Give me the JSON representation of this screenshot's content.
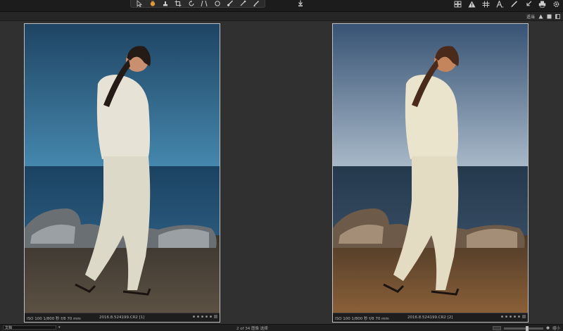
{
  "toolbar": {
    "tools": [
      "cursor-icon",
      "hand-icon",
      "stamp-icon",
      "crop-icon",
      "rotate-icon",
      "keystone-icon",
      "circle-icon",
      "brush-icon",
      "eyedropper-icon",
      "eraser-icon"
    ],
    "right_tools": [
      "grid-view-icon",
      "warning-icon",
      "grid-icon",
      "text-icon",
      "pen-icon",
      "compress-icon",
      "print-icon",
      "settings-icon"
    ]
  },
  "subbar": {
    "label": "适当"
  },
  "left_photo": {
    "caption_exif": "ISO 100  1/800 秒  f/8  70 mm",
    "caption_file": "2016.8.524199.CR2 [1]",
    "colors": {
      "sky_top": "#234c6b",
      "sky_bottom": "#3e7ea4",
      "sea": "#1f4666",
      "ground": "#4a4033"
    }
  },
  "right_photo": {
    "caption_exif": "ISO 100  1/800 秒  f/8  70 mm",
    "caption_file": "2016.8.524199.CR2 [2]",
    "colors": {
      "sky_top": "#3a5575",
      "sky_bottom": "#9fb2c4",
      "sea": "#2a3d52",
      "ground": "#6b4a2c"
    }
  },
  "bottombar": {
    "view_label": "文档",
    "counter": "2 of 34 图像 选择",
    "zoom_label": "缩小",
    "zoom_fraction": 0.6
  }
}
